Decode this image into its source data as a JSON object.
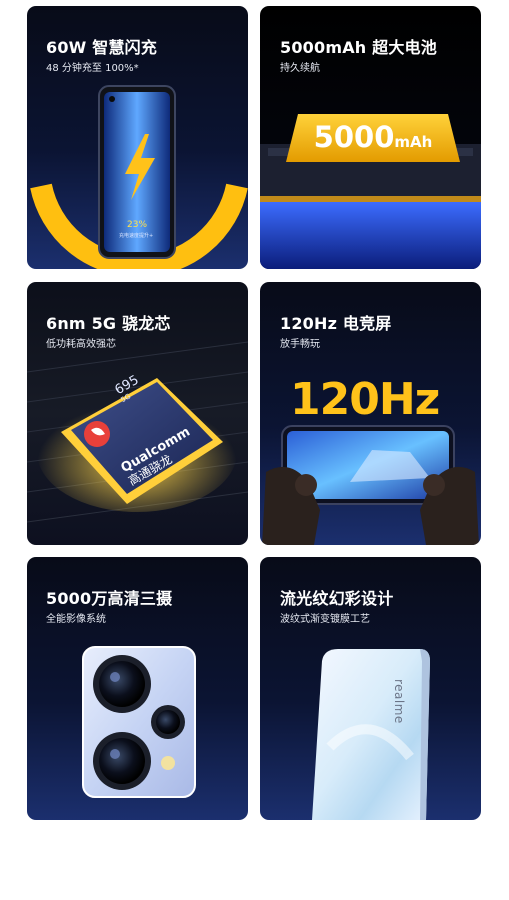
{
  "features": [
    {
      "title": "60W 智慧闪充",
      "subtitle": "48 分钟充至 100%*",
      "screen_percent": "23%",
      "screen_caption": "充电速度提升+"
    },
    {
      "title": "5000mAh 超大电池",
      "subtitle": "持久续航",
      "badge_big": "5000",
      "badge_small": "mAh"
    },
    {
      "title": "6nm 5G 骁龙芯",
      "subtitle": "低功耗高效强芯",
      "chip_model": "695",
      "chip_5g": "5G",
      "chip_brand": "Qualcomm",
      "chip_cn": "高通骁龙"
    },
    {
      "title": "120Hz 电竞屏",
      "subtitle": "放手畅玩",
      "big_text": "120Hz"
    },
    {
      "title": "5000万高清三摄",
      "subtitle": "全能影像系统"
    },
    {
      "title": "流光纹幻彩设计",
      "subtitle": "波纹式渐变镀膜工艺",
      "logo_text": "realme"
    }
  ],
  "colors": {
    "accent_yellow": "#ffc21a",
    "card_dark": "#0b1433",
    "card_blue": "#1b2f6e"
  }
}
